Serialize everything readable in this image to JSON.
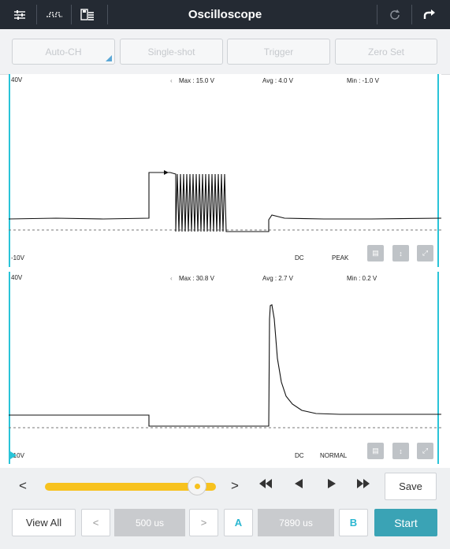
{
  "header": {
    "title": "Oscilloscope",
    "icons": [
      "settings-sliders-icon",
      "waveform-icon",
      "save-file-icon",
      "refresh-icon",
      "undo-icon"
    ]
  },
  "toolbar": {
    "auto_ch": "Auto-CH",
    "single_shot": "Single-shot",
    "trigger": "Trigger",
    "zero_set": "Zero Set"
  },
  "channel1": {
    "top_label": "40V",
    "bottom_label": "-10V",
    "max": "Max : 15.0 V",
    "avg": "Avg : 4.0 V",
    "min": "Min : -1.0 V",
    "coupling": "DC",
    "mode": "PEAK"
  },
  "channel2": {
    "top_label": "40V",
    "bottom_label": "-10V",
    "max": "Max : 30.8 V",
    "avg": "Avg : 2.7 V",
    "min": "Min : 0.2 V",
    "coupling": "DC",
    "mode": "NORMAL"
  },
  "playback": {
    "prev": "<",
    "next": ">",
    "save": "Save",
    "slider_position": 0.89,
    "accent_color": "#f7c21e"
  },
  "bottom": {
    "view_all": "View All",
    "dec": "<",
    "timebase": "500 us",
    "inc": ">",
    "cursor_a": "A",
    "cursor_value": "7890 us",
    "cursor_b": "B",
    "start": "Start"
  },
  "colors": {
    "header_bg": "#242a33",
    "channel_line": "#29c4d8",
    "start_bg": "#3aa3b5",
    "cursor_text": "#2bb7d1"
  }
}
